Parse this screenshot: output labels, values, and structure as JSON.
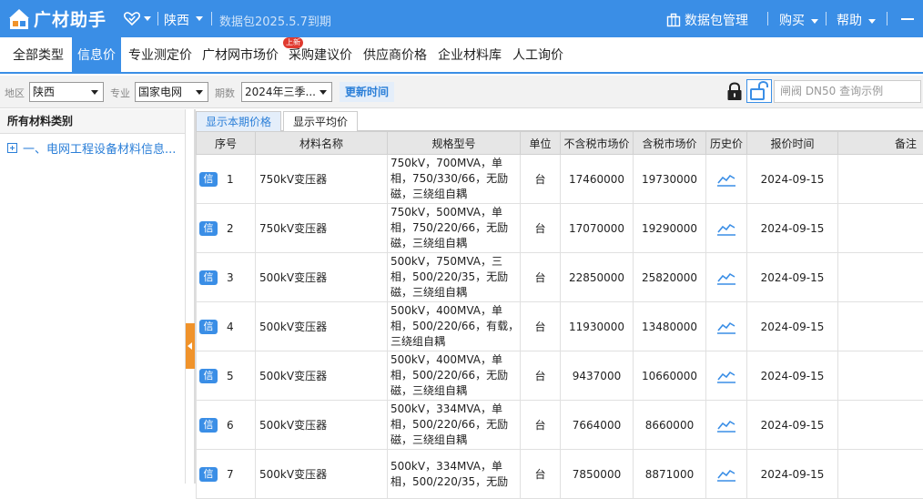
{
  "topbar": {
    "app_name": "广材助手",
    "region": "陕西",
    "expiry": "数据包2025.5.7到期",
    "data_pkg_mgmt": "数据包管理",
    "buy": "购买",
    "help": "帮助",
    "bg_color": "#3a8ee6"
  },
  "nav": {
    "items": [
      "全部类型",
      "信息价",
      "专业测定价",
      "广材网市场价",
      "采购建议价",
      "供应商价格",
      "企业材料库",
      "人工询价"
    ],
    "active_index": 1,
    "new_badge": "上新"
  },
  "filters": {
    "region_label": "地区",
    "region_value": "陕西",
    "specialty_label": "专业",
    "specialty_value": "国家电网",
    "period_label": "期数",
    "period_value": "2024年三季...",
    "update_time": "更新时间",
    "search_placeholder": "闸阀 DN50 查询示例"
  },
  "sidebar": {
    "header": "所有材料类别",
    "item": "一、电网工程设备材料信息..."
  },
  "tabs": {
    "current": "显示本期价格",
    "average": "显示平均价"
  },
  "table": {
    "headers": {
      "idx": "序号",
      "name": "材料名称",
      "spec": "规格型号",
      "unit": "单位",
      "pretax": "不含税市场价",
      "taxed": "含税市场价",
      "history": "历史价",
      "date": "报价时间",
      "note": "备注"
    },
    "badge": "信",
    "rows": [
      {
        "idx": "1",
        "name": "750kV变压器",
        "spec": "750kV，700MVA，单相，750/330/66，无励磁，三绕组自耦",
        "unit": "台",
        "pretax": "17460000",
        "taxed": "19730000",
        "date": "2024-09-15"
      },
      {
        "idx": "2",
        "name": "750kV变压器",
        "spec": "750kV，500MVA，单相，750/220/66，无励磁，三绕组自耦",
        "unit": "台",
        "pretax": "17070000",
        "taxed": "19290000",
        "date": "2024-09-15"
      },
      {
        "idx": "3",
        "name": "500kV变压器",
        "spec": "500kV，750MVA，三相，500/220/35，无励磁，三绕组自耦",
        "unit": "台",
        "pretax": "22850000",
        "taxed": "25820000",
        "date": "2024-09-15"
      },
      {
        "idx": "4",
        "name": "500kV变压器",
        "spec": "500kV，400MVA，单相，500/220/66，有载，三绕组自耦",
        "unit": "台",
        "pretax": "11930000",
        "taxed": "13480000",
        "date": "2024-09-15"
      },
      {
        "idx": "5",
        "name": "500kV变压器",
        "spec": "500kV，400MVA，单相，500/220/66，无励磁，三绕组自耦",
        "unit": "台",
        "pretax": "9437000",
        "taxed": "10660000",
        "date": "2024-09-15"
      },
      {
        "idx": "6",
        "name": "500kV变压器",
        "spec": "500kV，334MVA，单相，500/220/66，无励磁，三绕组自耦",
        "unit": "台",
        "pretax": "7664000",
        "taxed": "8660000",
        "date": "2024-09-15"
      },
      {
        "idx": "7",
        "name": "500kV变压器",
        "spec": "500kV，334MVA，单相，500/220/35，无励",
        "unit": "台",
        "pretax": "7850000",
        "taxed": "8871000",
        "date": "2024-09-15"
      }
    ]
  }
}
